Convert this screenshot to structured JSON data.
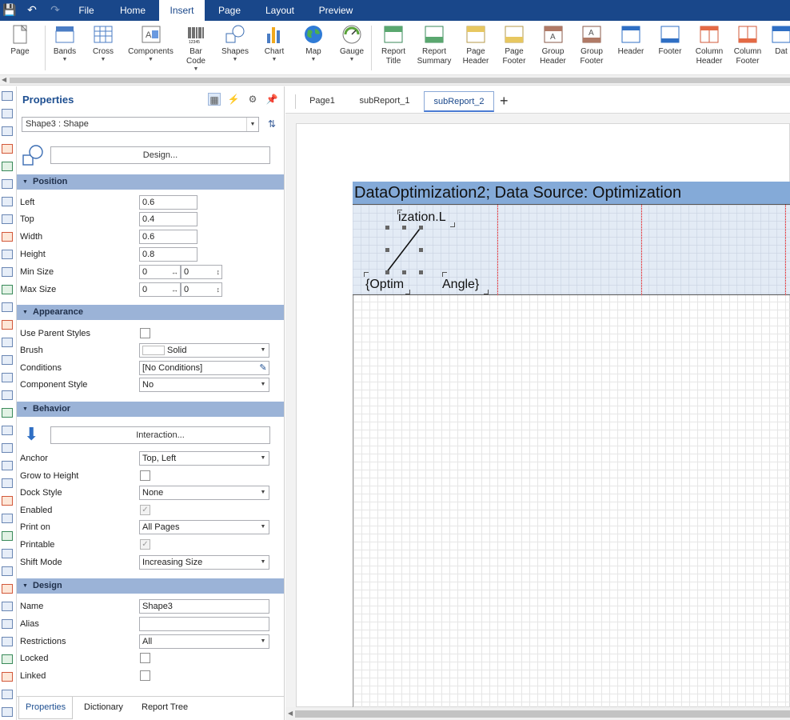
{
  "menu": {
    "tabs": [
      "File",
      "Home",
      "Insert",
      "Page",
      "Layout",
      "Preview"
    ],
    "active": "Insert"
  },
  "ribbon": [
    {
      "label": "Page",
      "icon": "page-icon",
      "arrow": false
    },
    {
      "label": "Bands",
      "icon": "bands-icon",
      "arrow": true
    },
    {
      "label": "Cross",
      "icon": "cross-icon",
      "arrow": true
    },
    {
      "label": "Components",
      "icon": "components-icon",
      "arrow": true
    },
    {
      "label": "Bar Code",
      "icon": "barcode-icon",
      "arrow": true
    },
    {
      "label": "Shapes",
      "icon": "shapes-icon",
      "arrow": true
    },
    {
      "label": "Chart",
      "icon": "chart-icon",
      "arrow": true
    },
    {
      "label": "Map",
      "icon": "map-icon",
      "arrow": true
    },
    {
      "label": "Gauge",
      "icon": "gauge-icon",
      "arrow": true
    },
    {
      "label": "Report Title",
      "icon": "report-title-icon",
      "arrow": false
    },
    {
      "label": "Report Summary",
      "icon": "report-summary-icon",
      "arrow": false
    },
    {
      "label": "Page Header",
      "icon": "page-header-icon",
      "arrow": false
    },
    {
      "label": "Page Footer",
      "icon": "page-footer-icon",
      "arrow": false
    },
    {
      "label": "Group Header",
      "icon": "group-header-icon",
      "arrow": false
    },
    {
      "label": "Group Footer",
      "icon": "group-footer-icon",
      "arrow": false
    },
    {
      "label": "Header",
      "icon": "header-icon",
      "arrow": false
    },
    {
      "label": "Footer",
      "icon": "footer-icon",
      "arrow": false
    },
    {
      "label": "Column Header",
      "icon": "column-header-icon",
      "arrow": false
    },
    {
      "label": "Column Footer",
      "icon": "column-footer-icon",
      "arrow": false
    },
    {
      "label": "Dat",
      "icon": "data-band-icon",
      "arrow": false
    }
  ],
  "properties": {
    "title": "Properties",
    "selected": "Shape3 : Shape",
    "design_button": "Design...",
    "sections": {
      "position": "Position",
      "appearance": "Appearance",
      "behavior": "Behavior",
      "design": "Design"
    },
    "position": {
      "left_label": "Left",
      "left": "0.6",
      "top_label": "Top",
      "top": "0.4",
      "width_label": "Width",
      "width": "0.6",
      "height_label": "Height",
      "height": "0.8",
      "min_label": "Min Size",
      "min_a": "0",
      "min_b": "0",
      "max_label": "Max Size",
      "max_a": "0",
      "max_b": "0"
    },
    "appearance": {
      "parent_label": "Use Parent Styles",
      "brush_label": "Brush",
      "brush": "Solid",
      "conditions_label": "Conditions",
      "conditions": "[No Conditions]",
      "style_label": "Component Style",
      "style": "No"
    },
    "behavior": {
      "interaction": "Interaction...",
      "anchor_label": "Anchor",
      "anchor": "Top, Left",
      "grow_label": "Grow to Height",
      "dock_label": "Dock Style",
      "dock": "None",
      "enabled_label": "Enabled",
      "print_label": "Print on",
      "print": "All Pages",
      "printable_label": "Printable",
      "shift_label": "Shift Mode",
      "shift": "Increasing Size"
    },
    "design": {
      "name_label": "Name",
      "name": "Shape3",
      "alias_label": "Alias",
      "alias": "",
      "restrictions_label": "Restrictions",
      "restrictions": "All",
      "locked_label": "Locked",
      "linked_label": "Linked"
    },
    "bottom_tabs": [
      "Properties",
      "Dictionary",
      "Report Tree"
    ]
  },
  "designer": {
    "tabs": [
      "Page1",
      "subReport_1",
      "subReport_2"
    ],
    "active_tab": "subReport_2",
    "add_tab": "+",
    "band_header": "DataOptimization2; Data Source: Optimization",
    "text1": "ization.L",
    "text2": "{Optim",
    "text3": "Angle}"
  }
}
